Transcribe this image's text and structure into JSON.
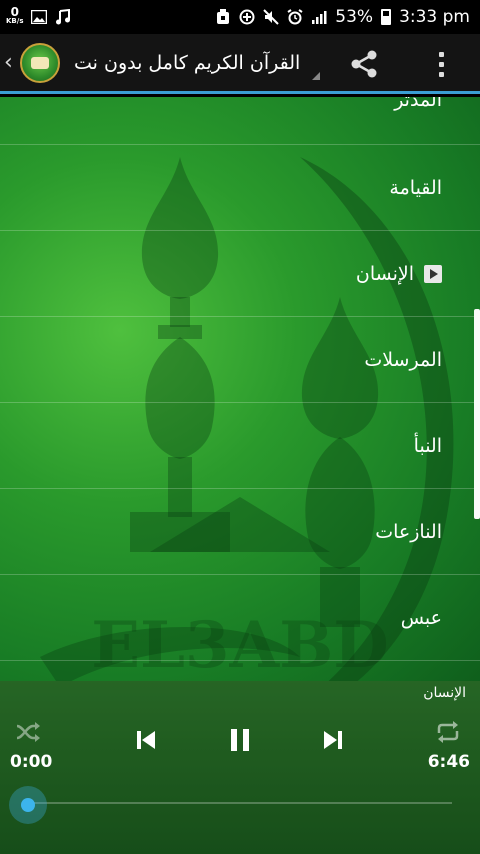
{
  "status_bar": {
    "net_speed_value": "0",
    "net_speed_unit": "KB/s",
    "battery_percent": "53%",
    "time": "3:33 pm",
    "left_icons": [
      "image-icon",
      "music-note-icon"
    ],
    "right_icons": [
      "usb-icon",
      "data-saver-icon",
      "mute-icon",
      "alarm-icon",
      "signal-icon",
      "battery-icon"
    ]
  },
  "action_bar": {
    "title": "القرآن الكريم كامل بدون نت",
    "share_icon": "share-icon",
    "menu_icon": "overflow-menu-icon",
    "accent": "#3b9ed4"
  },
  "list": {
    "items": [
      {
        "label": "المدثر"
      },
      {
        "label": "القيامة"
      },
      {
        "label": "الإنسان"
      },
      {
        "label": "المرسلات"
      },
      {
        "label": "النبأ"
      },
      {
        "label": "النازعات"
      },
      {
        "label": "عبس"
      }
    ],
    "playing_index": 2
  },
  "watermark": {
    "text": "EL3ABD"
  },
  "player": {
    "now_playing": "الإنسان",
    "current_time": "0:00",
    "total_time": "6:46",
    "progress": 0,
    "accent": "#3cb4ec"
  }
}
